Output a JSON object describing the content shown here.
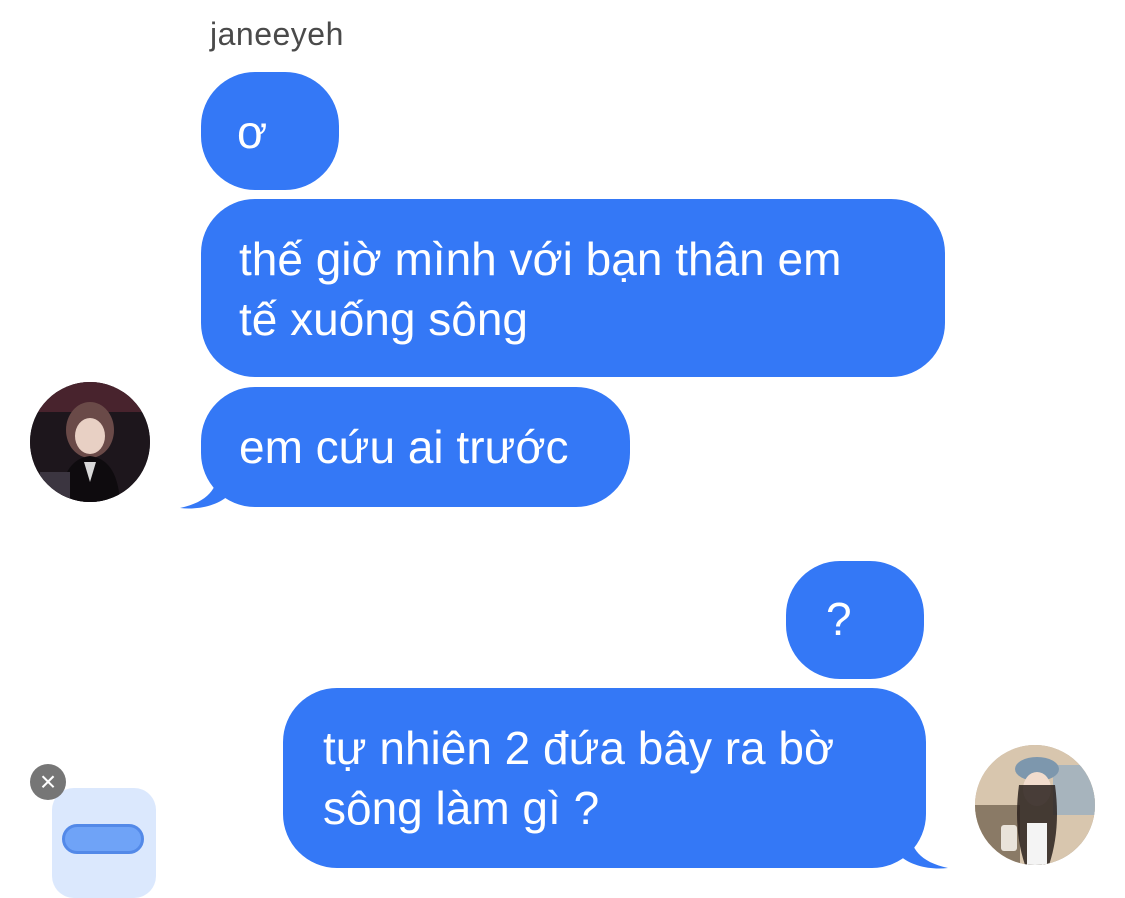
{
  "conversation": {
    "sender_name": "janeeyeh",
    "incoming": [
      {
        "text": "ơ"
      },
      {
        "text": "thế giờ mình với bạn thân em\ntế xuống sông"
      },
      {
        "text": "em cứu ai trước"
      }
    ],
    "outgoing": [
      {
        "text": "?"
      },
      {
        "text": "tự nhiên 2 đứa bây ra bờ\nsông làm gì ?"
      }
    ]
  },
  "icons": {
    "draft_close": "×",
    "draft_close_name": "close-icon"
  },
  "colors": {
    "bubble_blue": "#3478f6",
    "background": "#ffffff",
    "sender_text": "#4a4a4a",
    "draft_card": "#dbe8fd",
    "draft_pill": "#6fa3f7"
  }
}
